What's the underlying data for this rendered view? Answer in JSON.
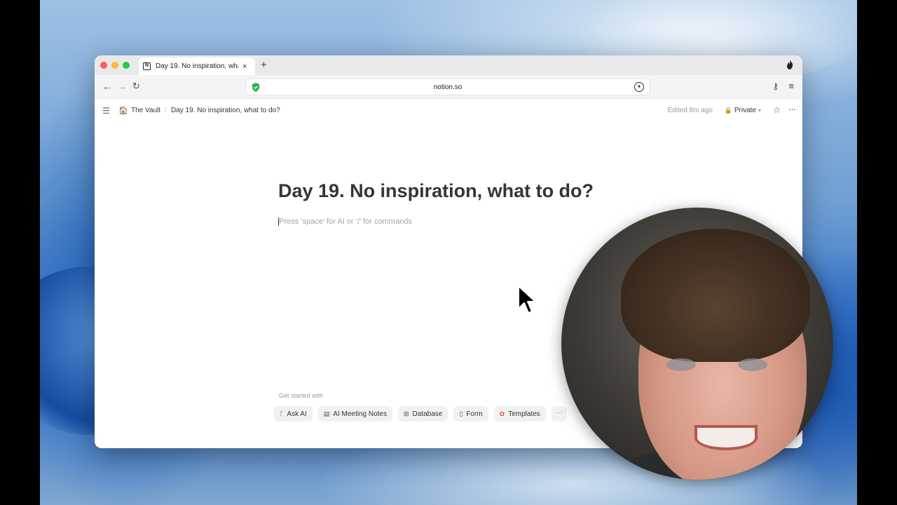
{
  "browser": {
    "tab_title": "Day 19. No inspiration, what to do?",
    "tab_close": "×",
    "new_tab": "+",
    "url": "notion.so",
    "nav_back": "←",
    "nav_forward": "→",
    "nav_reload": "↻",
    "menu": "≡"
  },
  "notion_header": {
    "workspace": "The Vault",
    "separator": "/",
    "page": "Day 19. No inspiration, what to do?",
    "edited": "Edited 8m ago",
    "private_label": "Private",
    "star": "☆",
    "more": "···"
  },
  "page": {
    "title": "Day 19. No inspiration, what to do?",
    "placeholder": "Press ‘space’ for AI or ‘/’ for commands",
    "get_started": "Get started with",
    "quick_actions": [
      {
        "label": "Ask AI",
        "icon": "ai-spark-icon"
      },
      {
        "label": "AI Meeting Notes",
        "icon": "meeting-notes-icon"
      },
      {
        "label": "Database",
        "icon": "table-icon"
      },
      {
        "label": "Form",
        "icon": "form-icon"
      },
      {
        "label": "Templates",
        "icon": "templates-icon"
      }
    ],
    "more": "···"
  },
  "colors": {
    "notion_text": "#37352f",
    "muted_text": "#9b9a97",
    "chip_bg": "#f1f1ef",
    "url_shield": "#2fb24c"
  }
}
